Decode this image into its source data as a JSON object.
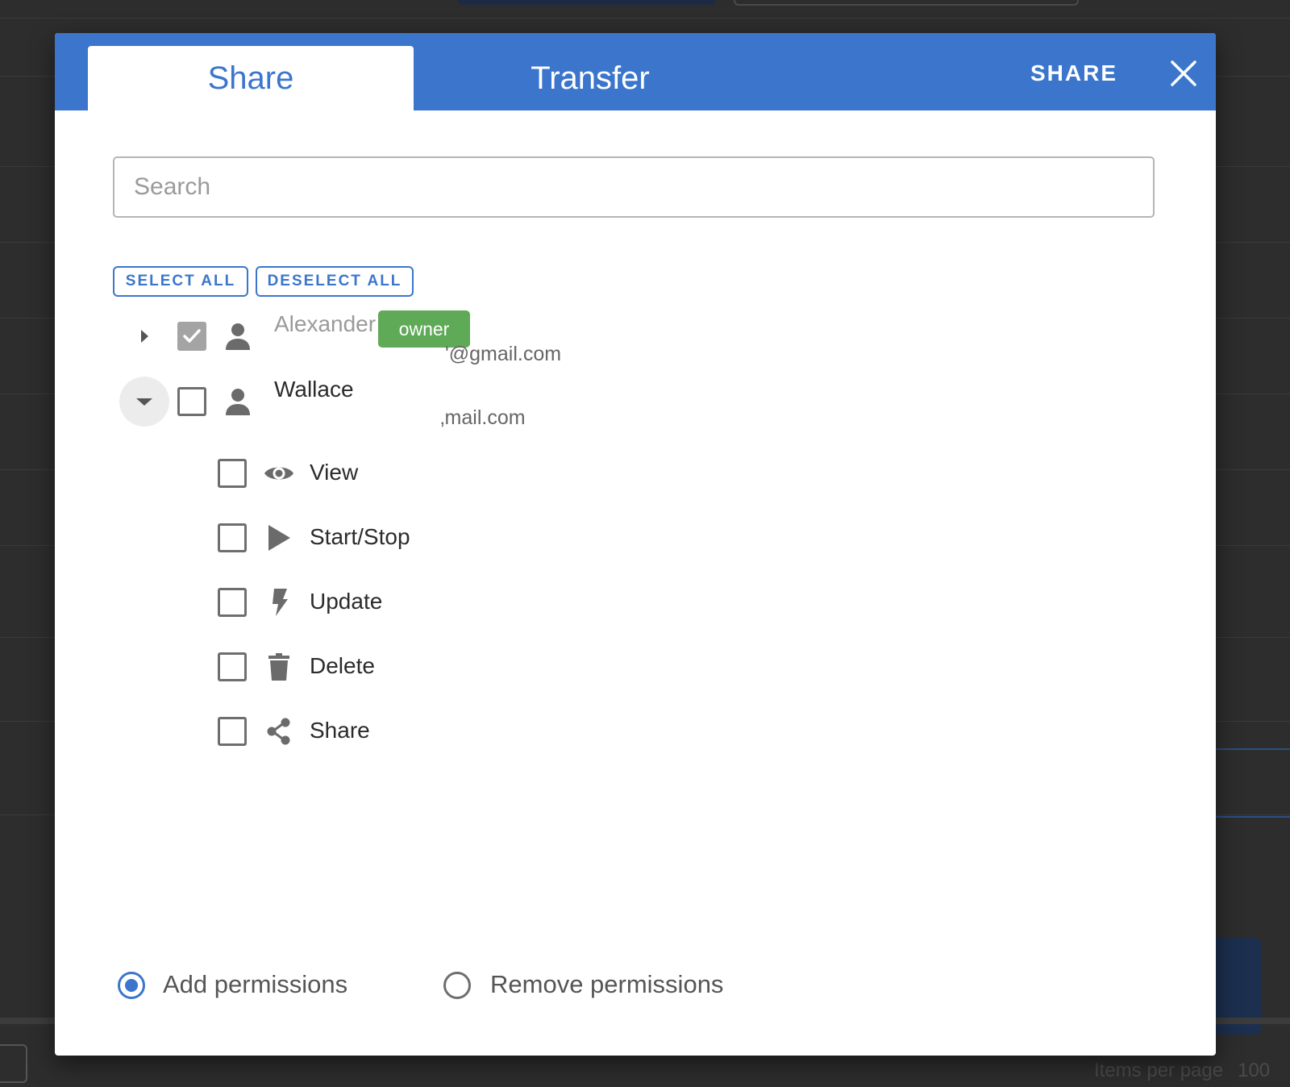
{
  "dialog": {
    "tabs": [
      {
        "label": "Share",
        "active": true
      },
      {
        "label": "Transfer",
        "active": false
      }
    ],
    "action_label": "SHARE",
    "close_icon": "close-icon",
    "search": {
      "placeholder": "Search",
      "value": ""
    },
    "select_all_label": "SELECT ALL",
    "deselect_all_label": "DESELECT ALL",
    "users": [
      {
        "name": "Alexander",
        "email": "'@gmail.com",
        "badge": "owner",
        "checked": true,
        "expanded": false,
        "icon": "person-icon"
      },
      {
        "name": "Wallace",
        "email": "‚mail.com",
        "checked": false,
        "expanded": true,
        "icon": "person-icon"
      }
    ],
    "permissions": [
      {
        "label": "View",
        "icon": "eye-icon",
        "checked": false
      },
      {
        "label": "Start/Stop",
        "icon": "play-icon",
        "checked": false
      },
      {
        "label": "Update",
        "icon": "bolt-icon",
        "checked": false
      },
      {
        "label": "Delete",
        "icon": "trash-icon",
        "checked": false
      },
      {
        "label": "Share",
        "icon": "share-icon",
        "checked": false
      }
    ],
    "mode_options": [
      {
        "label": "Add permissions",
        "selected": true
      },
      {
        "label": "Remove permissions",
        "selected": false
      }
    ]
  },
  "background": {
    "items_per_page_label": "Items per page",
    "items_per_page_value": "100"
  },
  "colors": {
    "accent": "#3b76cc",
    "owner_badge": "#5faa56",
    "overlay": "#2d2d2d"
  }
}
